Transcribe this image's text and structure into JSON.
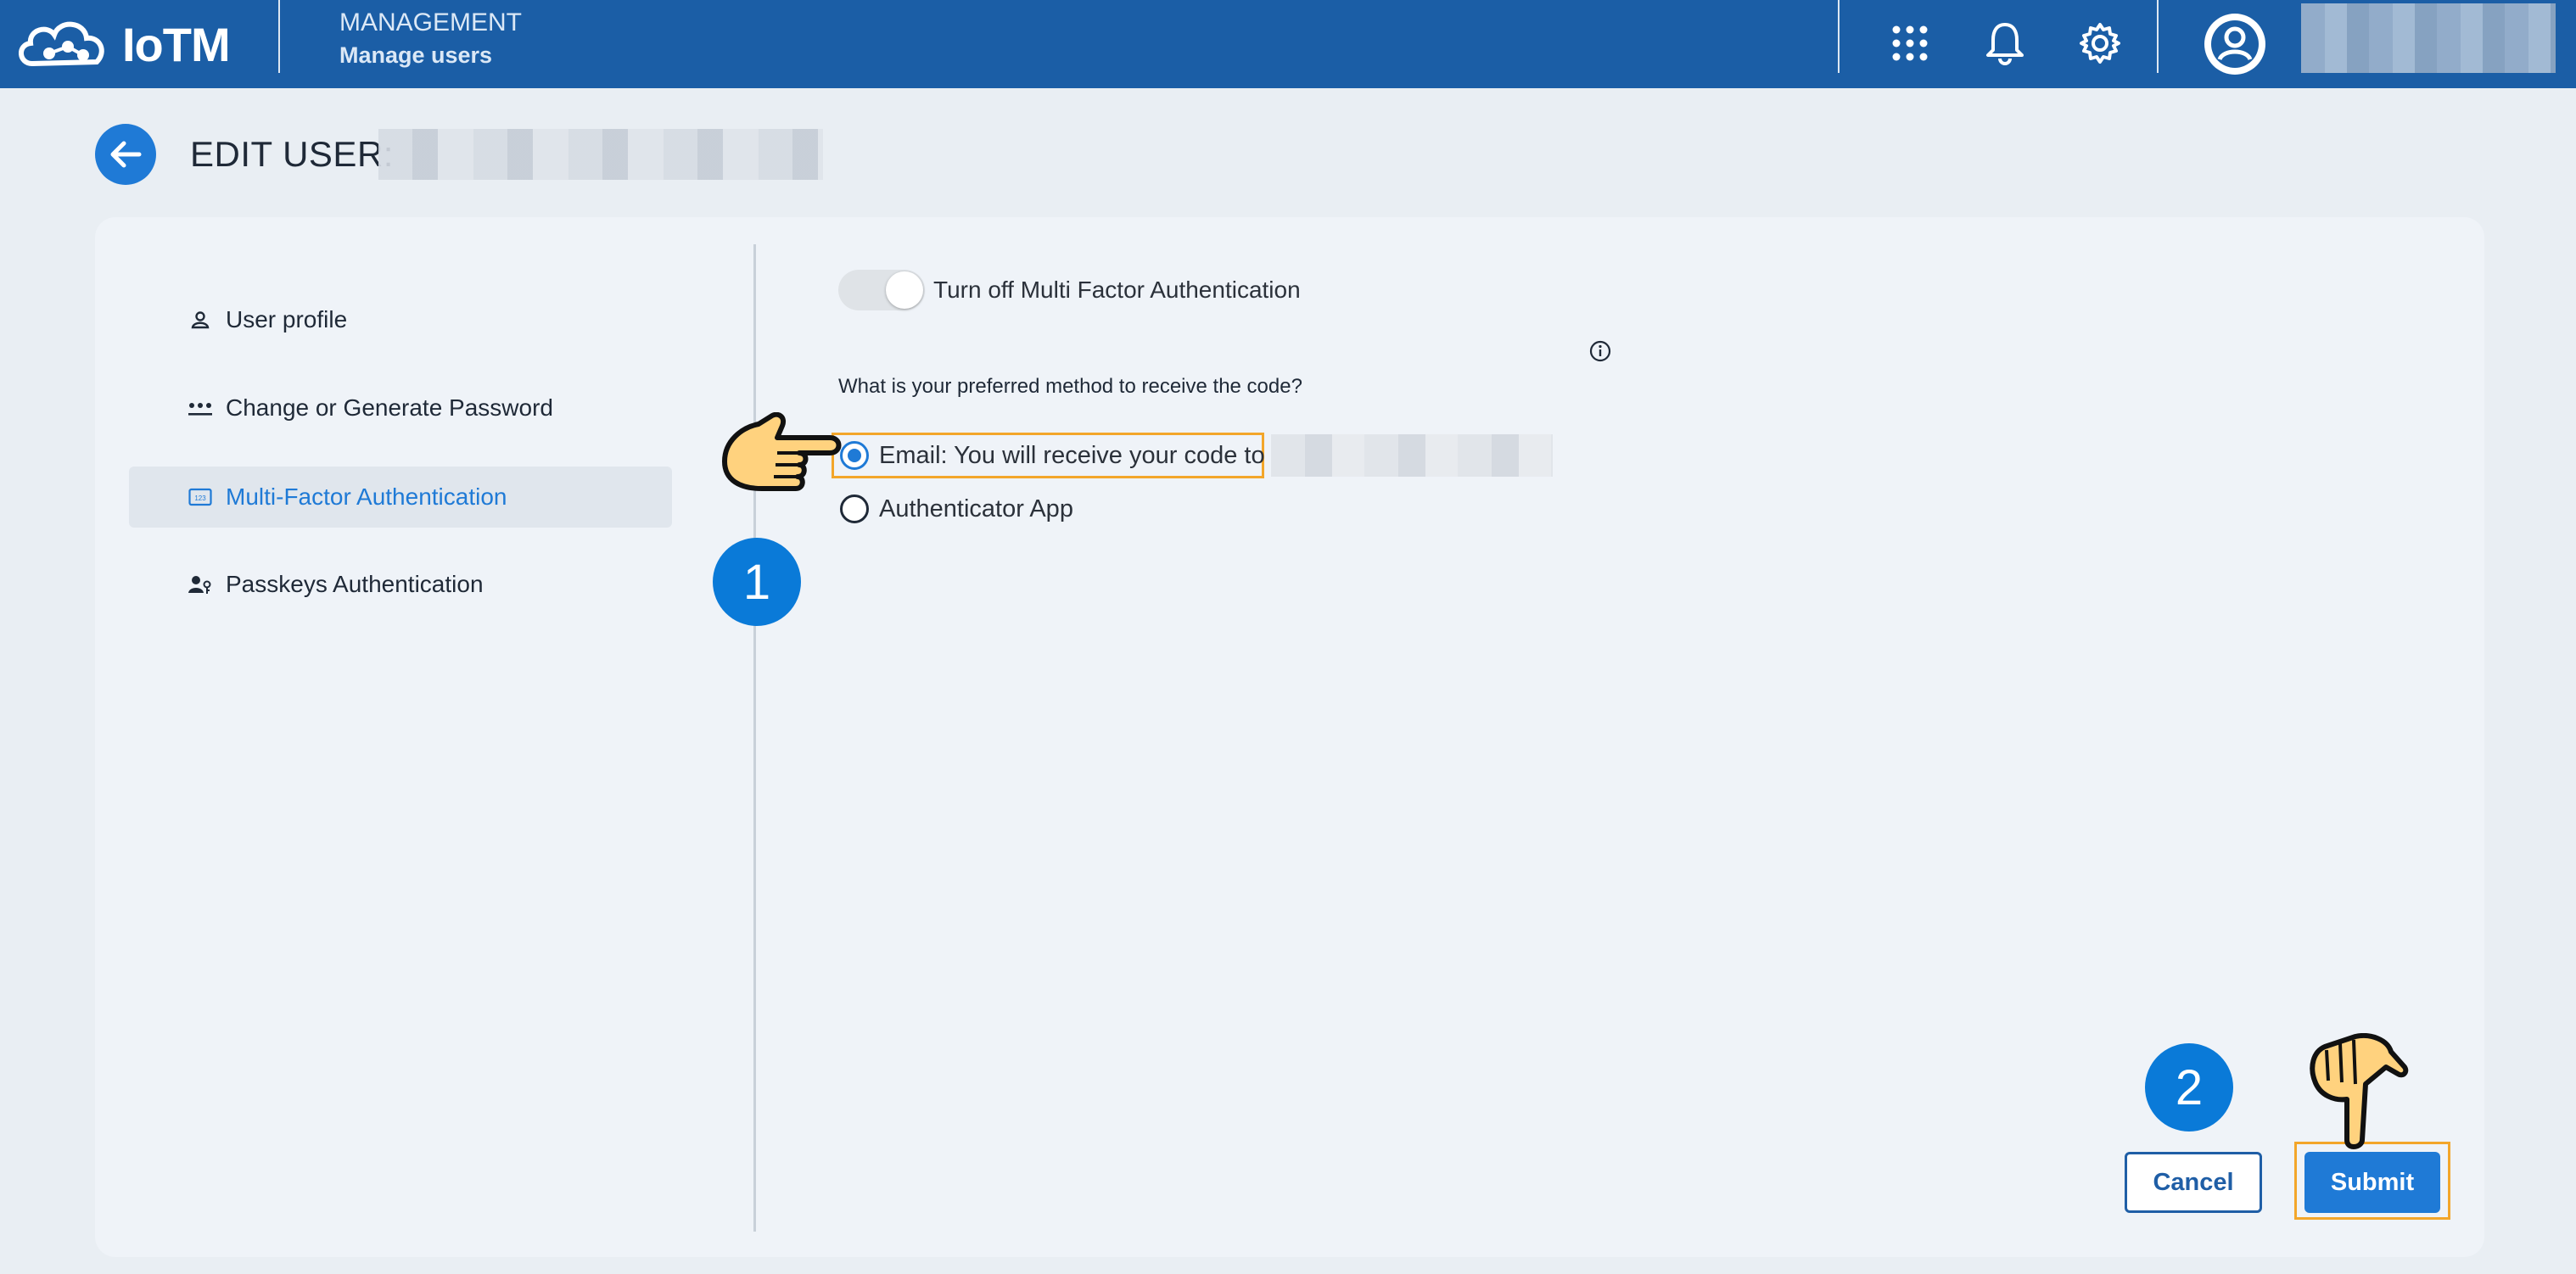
{
  "app": {
    "logo_text": "IoTM",
    "module_name": "MANAGEMENT",
    "module_sub": "Manage users"
  },
  "topbar_icons": [
    "apps-grid-icon",
    "bell-icon",
    "gear-icon",
    "user-avatar-icon"
  ],
  "page": {
    "title": "EDIT USER:"
  },
  "sidebar": {
    "items": [
      {
        "label": "User profile",
        "icon": "person-icon",
        "active": false
      },
      {
        "label": "Change or Generate Password",
        "icon": "password-dots-icon",
        "active": false
      },
      {
        "label": "Multi-Factor Authentication",
        "icon": "mfa-123-icon",
        "active": true
      },
      {
        "label": "Passkeys Authentication",
        "icon": "person-key-icon",
        "active": false
      }
    ]
  },
  "mfa": {
    "toggle_label": "Turn off Multi Factor Authentication",
    "question": "What is your preferred method to receive the code?",
    "options": [
      {
        "label": "Email: You will receive your code to",
        "checked": true
      },
      {
        "label": "Authenticator App",
        "checked": false
      }
    ]
  },
  "actions": {
    "cancel_label": "Cancel",
    "submit_label": "Submit"
  },
  "annotations": {
    "step1": "1",
    "step2": "2"
  },
  "colors": {
    "topbar": "#1b5ea6",
    "accent": "#1f7ad6",
    "highlight": "#f3a62a",
    "step_badge": "#0a7ad8"
  }
}
